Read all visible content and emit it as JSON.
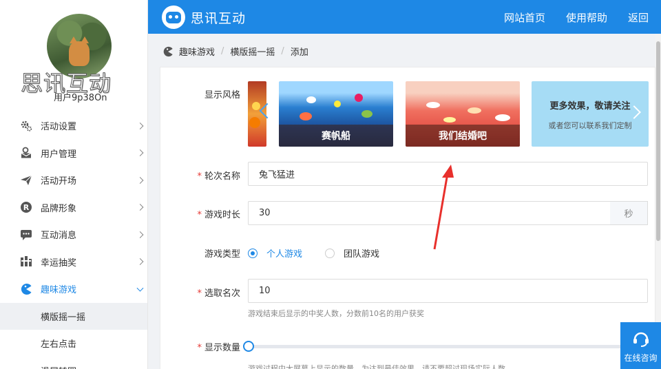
{
  "sidebar": {
    "brand_text": "思讯互动",
    "username": "用户9p38On",
    "items": [
      {
        "label": "活动设置",
        "icon": "gear-icon"
      },
      {
        "label": "用户管理",
        "icon": "user-envelope-icon"
      },
      {
        "label": "活动开场",
        "icon": "paper-plane-icon"
      },
      {
        "label": "品牌形象",
        "icon": "registered-icon"
      },
      {
        "label": "互动消息",
        "icon": "chat-bubble-icon"
      },
      {
        "label": "幸运抽奖",
        "icon": "lottery-icon"
      },
      {
        "label": "趣味游戏",
        "icon": "pacman-icon"
      }
    ],
    "sub_items": [
      {
        "label": "横版摇一摇"
      },
      {
        "label": "左右点击"
      },
      {
        "label": "滑屏转圈"
      }
    ]
  },
  "header": {
    "logo_text": "思讯互动",
    "nav": [
      "网站首页",
      "使用帮助",
      "返回"
    ]
  },
  "breadcrumb": [
    "趣味游戏",
    "横版摇一摇",
    "添加"
  ],
  "form": {
    "style_label": "显示风格",
    "styles": [
      {
        "caption": "赛帆船"
      },
      {
        "caption": "我们结婚吧"
      }
    ],
    "more_title": "更多效果，敬请关注",
    "more_sub": "或者您可以联系我们定制",
    "round_label": "轮次名称",
    "round_value": "兔飞猛进",
    "duration_label": "游戏时长",
    "duration_value": "30",
    "duration_unit": "秒",
    "type_label": "游戏类型",
    "type_options": [
      "个人游戏",
      "团队游戏"
    ],
    "rank_label": "选取名次",
    "rank_value": "10",
    "rank_help": "游戏结束后显示的中奖人数，分数前10名的用户获奖",
    "count_label": "显示数量",
    "count_help": "游戏过程中大屏幕上显示的数量，为达到最佳效果，请不要超过现场实际人数"
  },
  "support": {
    "label": "在线咨询"
  },
  "colors": {
    "primary": "#1e88e5",
    "required": "#e53935",
    "annotation_arrow": "#e8302c"
  }
}
